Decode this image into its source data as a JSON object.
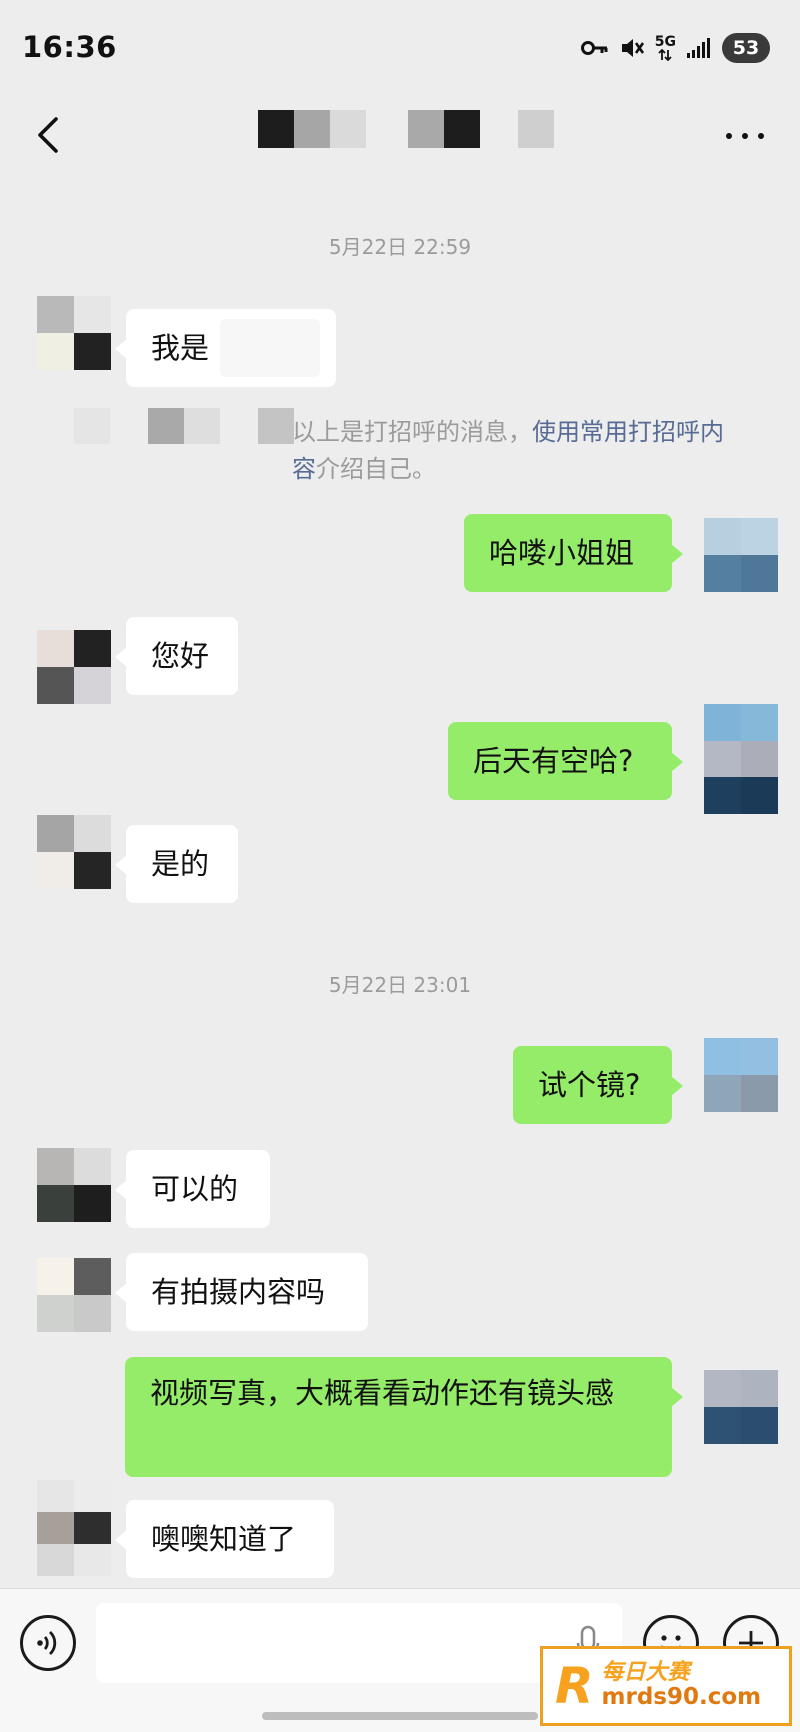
{
  "status_bar": {
    "time": "16:36",
    "network": "5G",
    "battery": "53",
    "icons": [
      "key-icon",
      "mute-icon",
      "5g-icon",
      "signal-icon",
      "battery-icon"
    ]
  },
  "header": {
    "back_icon": "chevron-left-icon",
    "more_icon": "more-dots-icon",
    "title_redacted": true
  },
  "chat": {
    "timestamps": [
      "5月22日 22:59",
      "5月22日 23:01"
    ],
    "system_note": {
      "prefix": "以上是打招呼的消息，",
      "link": "使用常用打招呼内容",
      "suffix": "介绍自己。"
    },
    "messages": [
      {
        "side": "in",
        "text": "我是"
      },
      {
        "side": "out",
        "text": "哈喽小姐姐"
      },
      {
        "side": "in",
        "text": "您好"
      },
      {
        "side": "out",
        "text": "后天有空哈?"
      },
      {
        "side": "in",
        "text": "是的"
      },
      {
        "side": "out",
        "text": "试个镜?"
      },
      {
        "side": "in",
        "text": "可以的"
      },
      {
        "side": "in",
        "text": "有拍摄内容吗"
      },
      {
        "side": "out",
        "text": "视频写真，大概看看动作还有镜头感"
      },
      {
        "side": "in",
        "text": "噢噢知道了"
      }
    ]
  },
  "input_bar": {
    "voice_icon": "voice-icon",
    "emoji_icon": "emoji-icon",
    "plus_icon": "plus-icon",
    "mic_icon": "mic-icon",
    "value": ""
  },
  "watermark": {
    "logo_letter": "R",
    "text": "每日大赛",
    "url": "mrds90.com"
  },
  "colors": {
    "background": "#ededed",
    "incoming_bubble": "#ffffff",
    "outgoing_bubble": "#95ec69",
    "link": "#576b95",
    "timestamp": "#9b9b9b"
  }
}
